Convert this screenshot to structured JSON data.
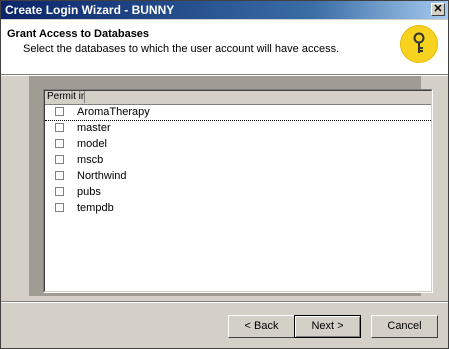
{
  "window": {
    "title": "Create Login Wizard - BUNNY",
    "close_glyph": "✕"
  },
  "header": {
    "title": "Grant Access to Databases",
    "subtitle": "Select the databases to which the user account will have access.",
    "icon": "key-icon"
  },
  "list": {
    "columns": {
      "permit": "Permit in database",
      "database": ""
    },
    "rows": [
      {
        "name": "AromaTherapy",
        "checked": false,
        "selected": true
      },
      {
        "name": "master",
        "checked": false
      },
      {
        "name": "model",
        "checked": false
      },
      {
        "name": "mscb",
        "checked": false
      },
      {
        "name": "Northwind",
        "checked": false
      },
      {
        "name": "pubs",
        "checked": false
      },
      {
        "name": "tempdb",
        "checked": false
      }
    ]
  },
  "buttons": {
    "back": "< Back",
    "next": "Next >",
    "cancel": "Cancel"
  },
  "colors": {
    "titlebar_start": "#0a246a",
    "face": "#d4d0c8",
    "icon_bg": "#f7d21e"
  }
}
